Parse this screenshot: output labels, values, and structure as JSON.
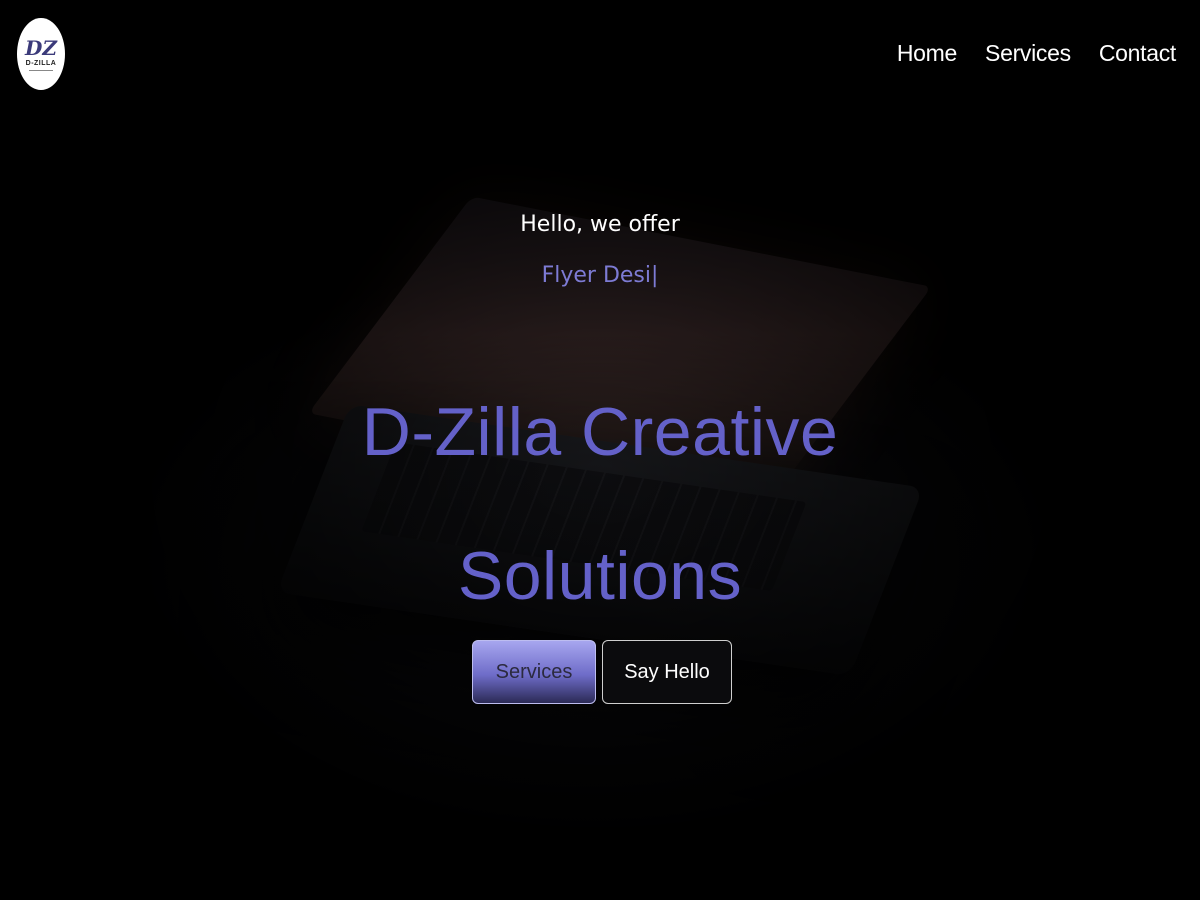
{
  "brand": {
    "logo_mark": "DZ",
    "logo_name": "D-ZILLA"
  },
  "nav": {
    "items": [
      {
        "label": "Home"
      },
      {
        "label": "Services"
      },
      {
        "label": "Contact"
      }
    ]
  },
  "hero": {
    "greeting": "Hello, we offer",
    "typed_text": "Flyer Desi|",
    "headline_line1": "D-Zilla Creative",
    "headline_line2": "Solutions",
    "buttons": {
      "services_label": "Services",
      "hello_label": "Say Hello"
    }
  },
  "colors": {
    "background": "#000000",
    "accent": "#6461c9",
    "typed": "#7d7bd4",
    "text": "#ffffff"
  }
}
